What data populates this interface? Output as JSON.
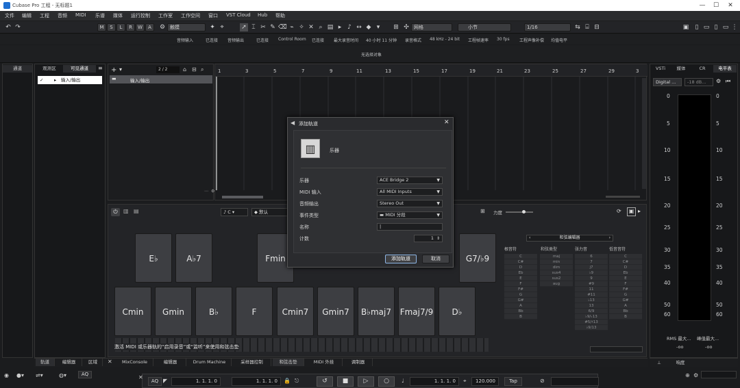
{
  "window": {
    "title": "Cubase Pro 工程 - 无标题1",
    "controls": [
      "—",
      "☐",
      "✕"
    ]
  },
  "menu": [
    "文件",
    "编辑",
    "工程",
    "音频",
    "MIDI",
    "乐谱",
    "媒体",
    "运行控制",
    "工作室",
    "工作空间",
    "窗口",
    "VST Cloud",
    "Hub",
    "帮助"
  ],
  "toolbar": {
    "modes": [
      "M",
      "S",
      "L",
      "R",
      "W",
      "A"
    ],
    "touch_mode": "触摸",
    "grid_type": "网格",
    "grid_unit": "小节",
    "quantize": "1/16"
  },
  "infobar": [
    "音频输入",
    "已连接",
    "音频输出",
    "已连接",
    "Control Room",
    "已连接",
    "最大录音时间",
    "40 小时 11 分钟",
    "录音格式",
    "48 kHz - 24 bit",
    "工程帧速率",
    "30 fps",
    "工程声像补偿",
    "均值电平"
  ],
  "status_text": "无选择对象",
  "left_zone": {
    "tab_left": "通道",
    "tabs": [
      "观测区",
      "可见通道"
    ],
    "track_item": "输入/输出",
    "track_counter": "2 / 2"
  },
  "tracks": {
    "folder_name": "输入/输出"
  },
  "ruler": [
    "1",
    "3",
    "5",
    "7",
    "9",
    "11",
    "13",
    "15",
    "17",
    "19",
    "21",
    "23",
    "25",
    "27",
    "29",
    "3"
  ],
  "chord_pad": {
    "key": "C",
    "preset": "默认",
    "velocity_label": "力度",
    "row1": [
      "E♭",
      "A♭7",
      "Fmin",
      "G7/♭9"
    ],
    "row2": [
      "Cmin",
      "Gmin",
      "B♭",
      "F",
      "Cmin7",
      "Gmin7",
      "B♭maj7",
      "Fmaj7/9",
      "D♭"
    ],
    "hint": "激活 MIDI 或乐器轨的“启用录音”或“监听”来使用和弦击垫",
    "editor_label": "和弦编辑器",
    "grid_headers": [
      "根音符",
      "和弦类型",
      "张力音",
      "低音音符"
    ],
    "grid_root": [
      "C",
      "C#",
      "D",
      "Eb",
      "E",
      "F",
      "F#",
      "G",
      "G#",
      "A",
      "Bb",
      "B"
    ],
    "grid_type": [
      "maj",
      "min",
      "dim",
      "sus4",
      "sus2",
      "aug"
    ],
    "grid_tension": [
      "6",
      "7",
      "j7",
      "♭9",
      "9",
      "#9",
      "11",
      "#11",
      "♭13",
      "13",
      "6/9",
      "♭9/♭13",
      "#5/♯13",
      "♭9/13"
    ],
    "grid_bass": [
      "C",
      "C#",
      "D",
      "Eb",
      "E",
      "F",
      "F#",
      "G",
      "G#",
      "A",
      "Bb",
      "B"
    ]
  },
  "bottom_tabs": [
    "轨道",
    "编辑器",
    "区域",
    "MixConsole",
    "编辑器",
    "Drum Machine",
    "采样器控制",
    "和弦击垫",
    "MIDI 外挂",
    "调制器"
  ],
  "right_zone": {
    "tabs": [
      "VSTi",
      "媒体",
      "CR",
      "电平表"
    ],
    "output": "Digital ...",
    "db_value": "-18 dB...",
    "scale_left": [
      "0",
      "5",
      "10",
      "15",
      "20",
      "25",
      "30",
      "35",
      "40",
      "50",
      "60"
    ],
    "scale_right": [
      "0",
      "5",
      "10",
      "15",
      "20",
      "25",
      "30",
      "35",
      "40",
      "50",
      "60"
    ],
    "rms_label": "RMS 最大...",
    "peak_label": "峰值最大...",
    "rms_value": "-oo",
    "peak_value": "-oo",
    "bottom_tab": "响度"
  },
  "dialog": {
    "title": "添加轨道",
    "category": "乐器",
    "rows": [
      {
        "label": "乐器",
        "value": "ACE Bridge 2"
      },
      {
        "label": "MIDI 输入",
        "value": "All MIDI Inputs"
      },
      {
        "label": "音频输出",
        "value": "Stereo Out"
      },
      {
        "label": "事件类型",
        "value": "MIDI 分段"
      }
    ],
    "name_label": "名称",
    "count_label": "计数",
    "count_value": "1",
    "add_button": "添加轨道",
    "cancel_button": "取消"
  },
  "transport": {
    "aq": "AQ",
    "left_locator": "1. 1. 1.  0",
    "right_locator": "1. 1. 1.  0",
    "position": "1. 1. 1.  0",
    "tempo": "120.000",
    "tap": "Tap",
    "aq_left": "AQ"
  }
}
